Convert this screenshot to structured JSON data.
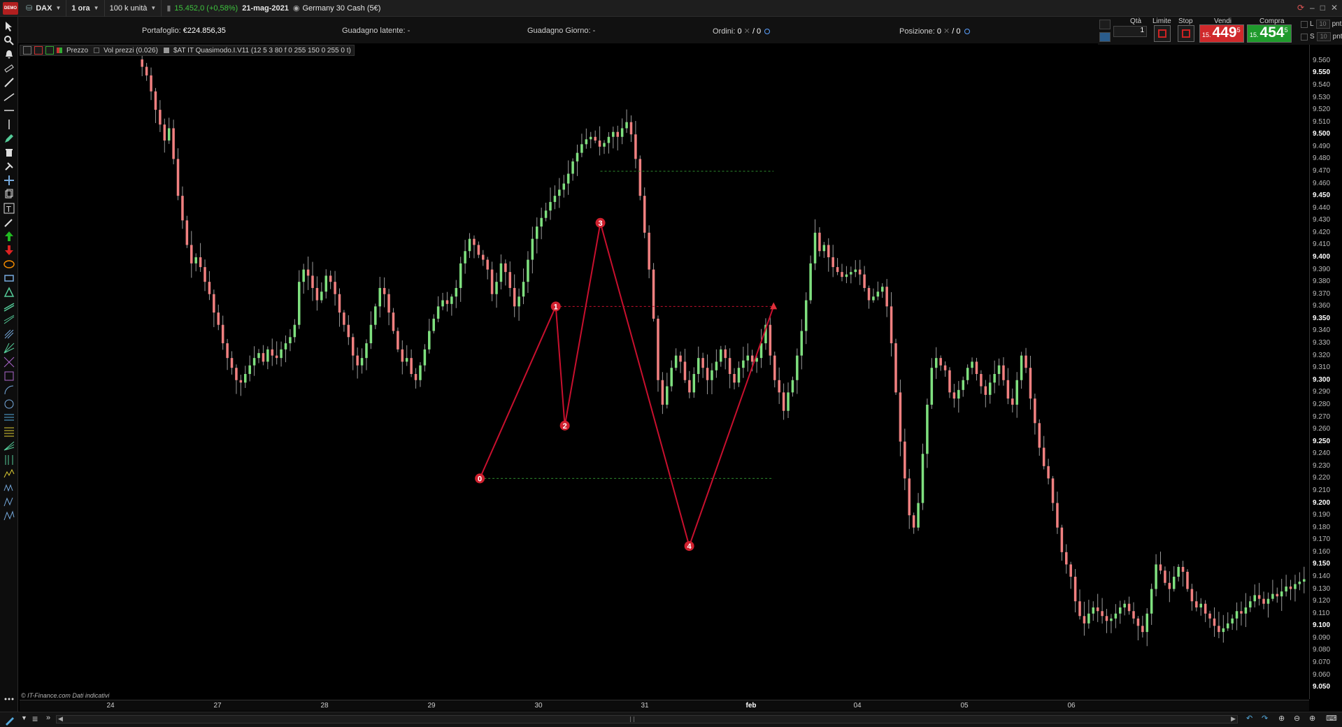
{
  "titlebar": {
    "logo": "DEMO",
    "instrument": "DAX",
    "timeframe": "1 ora",
    "units": "100 k unità",
    "last_price": "15.452,0 (+0,58%)",
    "date": "21-mag-2021",
    "instrument_desc": "Germany 30 Cash (5€)"
  },
  "info": {
    "portafoglio_label": "Portafoglio:",
    "portafoglio_value": "€224.856,35",
    "latente_label": "Guadagno latente:",
    "latente_value": "-",
    "giorno_label": "Guadagno Giorno:",
    "giorno_value": "-",
    "ordini_label": "Ordini:",
    "ordini_value": "0",
    "ordini_value2": "/ 0",
    "posizione_label": "Posizione:",
    "posizione_value": "0",
    "posizione_value2": "/ 0"
  },
  "order_panel": {
    "qty_label": "Qtà",
    "qty_value": "1",
    "limit_label": "Limite",
    "stop_label": "Stop",
    "sell_label": "Vendi",
    "buy_label": "Compra",
    "sell_prefix": "15.",
    "sell_price": "449",
    "sell_sup": "5",
    "buy_prefix": "15.",
    "buy_price": "454",
    "buy_sup": "5",
    "l_label": "L",
    "s_label": "S",
    "l_value": "10",
    "s_value": "10",
    "pnt_label": "pnt",
    "sell_color": "#d0292b",
    "buy_color": "#1f9a2c"
  },
  "legend": {
    "price": "Prezzo",
    "volume": "Vol prezzi (0.026)",
    "indicator": "$AT IT Quasimodo.I.V11 (12 5 3 80 f 0 255 150 0 255 0 t)"
  },
  "copyright": "© IT-Finance.com  Dati indicativi",
  "colors": {
    "bull": "#7fe07f",
    "bear": "#f08080",
    "pattern": "#c8102e",
    "levels": "#2e8b2e"
  },
  "chart_data": {
    "type": "candlestick",
    "price_axis_labels": [
      "9.560",
      "9.550",
      "9.540",
      "9.530",
      "9.520",
      "9.510",
      "9.500",
      "9.490",
      "9.480",
      "9.470",
      "9.460",
      "9.450",
      "9.440",
      "9.430",
      "9.420",
      "9.410",
      "9.400",
      "9.390",
      "9.380",
      "9.370",
      "9.360",
      "9.350",
      "9.340",
      "9.330",
      "9.320",
      "9.310",
      "9.300",
      "9.290",
      "9.280",
      "9.270",
      "9.260",
      "9.250",
      "9.240",
      "9.230",
      "9.220",
      "9.210",
      "9.200",
      "9.190",
      "9.180",
      "9.170",
      "9.160",
      "9.150",
      "9.140",
      "9.130",
      "9.120",
      "9.110",
      "9.100",
      "9.090",
      "9.080",
      "9.070",
      "9.060",
      "9.050"
    ],
    "ylim": [
      9045,
      9565
    ],
    "time_axis_labels": [
      "24",
      "27",
      "28",
      "29",
      "30",
      "31",
      "feb",
      "04",
      "05",
      "06"
    ],
    "pattern_points": [
      {
        "label": "0",
        "x_frac": 0.3569,
        "price": 9220
      },
      {
        "label": "1",
        "x_frac": 0.4158,
        "price": 9360
      },
      {
        "label": "2",
        "x_frac": 0.4228,
        "price": 9263
      },
      {
        "label": "3",
        "x_frac": 0.4504,
        "price": 9428
      },
      {
        "label": "4",
        "x_frac": 0.5193,
        "price": 9165
      },
      {
        "label": "",
        "x_frac": 0.5847,
        "price": 9360
      }
    ],
    "levels": [
      {
        "price": 9470,
        "style": "green-dashed",
        "from_frac": 0.4504,
        "to_frac": 0.5847
      },
      {
        "price": 9360,
        "style": "red-dashed",
        "from_frac": 0.4158,
        "to_frac": 0.5847
      },
      {
        "price": 9220,
        "style": "green-dashed",
        "from_frac": 0.3569,
        "to_frac": 0.5847
      }
    ],
    "closes": [
      9555,
      9548,
      9535,
      9520,
      9508,
      9495,
      9505,
      9480,
      9450,
      9430,
      9410,
      9395,
      9400,
      9392,
      9380,
      9370,
      9355,
      9345,
      9330,
      9318,
      9310,
      9300,
      9298,
      9305,
      9312,
      9318,
      9322,
      9315,
      9325,
      9320,
      9318,
      9325,
      9330,
      9335,
      9345,
      9380,
      9390,
      9385,
      9375,
      9365,
      9372,
      9385,
      9380,
      9370,
      9355,
      9345,
      9335,
      9320,
      9312,
      9318,
      9330,
      9345,
      9360,
      9375,
      9370,
      9355,
      9340,
      9325,
      9315,
      9318,
      9305,
      9300,
      9312,
      9325,
      9340,
      9350,
      9360,
      9365,
      9362,
      9368,
      9375,
      9395,
      9405,
      9415,
      9410,
      9402,
      9398,
      9390,
      9370,
      9380,
      9395,
      9388,
      9375,
      9360,
      9368,
      9380,
      9398,
      9415,
      9425,
      9432,
      9438,
      9445,
      9450,
      9455,
      9460,
      9468,
      9478,
      9485,
      9492,
      9496,
      9498,
      9495,
      9490,
      9493,
      9498,
      9502,
      9498,
      9505,
      9510,
      9500,
      9480,
      9450,
      9420,
      9390,
      9350,
      9300,
      9280,
      9295,
      9310,
      9320,
      9315,
      9300,
      9290,
      9305,
      9318,
      9310,
      9300,
      9308,
      9315,
      9325,
      9318,
      9305,
      9298,
      9310,
      9316,
      9320,
      9315,
      9318,
      9330,
      9345,
      9320,
      9300,
      9290,
      9275,
      9290,
      9300,
      9320,
      9340,
      9365,
      9395,
      9420,
      9405,
      9410,
      9400,
      9392,
      9388,
      9384,
      9386,
      9388,
      9390,
      9386,
      9375,
      9365,
      9368,
      9372,
      9376,
      9360,
      9330,
      9290,
      9250,
      9220,
      9190,
      9180,
      9200,
      9240,
      9280,
      9310,
      9318,
      9312,
      9308,
      9290,
      9285,
      9292,
      9300,
      9310,
      9315,
      9305,
      9295,
      9288,
      9298,
      9305,
      9312,
      9300,
      9285,
      9280,
      9300,
      9320,
      9310,
      9285,
      9265,
      9245,
      9230,
      9220,
      9200,
      9180,
      9160,
      9150,
      9140,
      9120,
      9108,
      9102,
      9110,
      9115,
      9112,
      9108,
      9104,
      9106,
      9110,
      9115,
      9118,
      9112,
      9106,
      9100,
      9095,
      9110,
      9130,
      9150,
      9145,
      9135,
      9130,
      9140,
      9148,
      9144,
      9130,
      9120,
      9115,
      9118,
      9110,
      9106,
      9100,
      9095,
      9098,
      9102,
      9106,
      9112,
      9110,
      9115,
      9120,
      9125,
      9122,
      9118,
      9122,
      9126,
      9124,
      9128,
      9132,
      9130,
      9134,
      9136,
      9138
    ]
  }
}
